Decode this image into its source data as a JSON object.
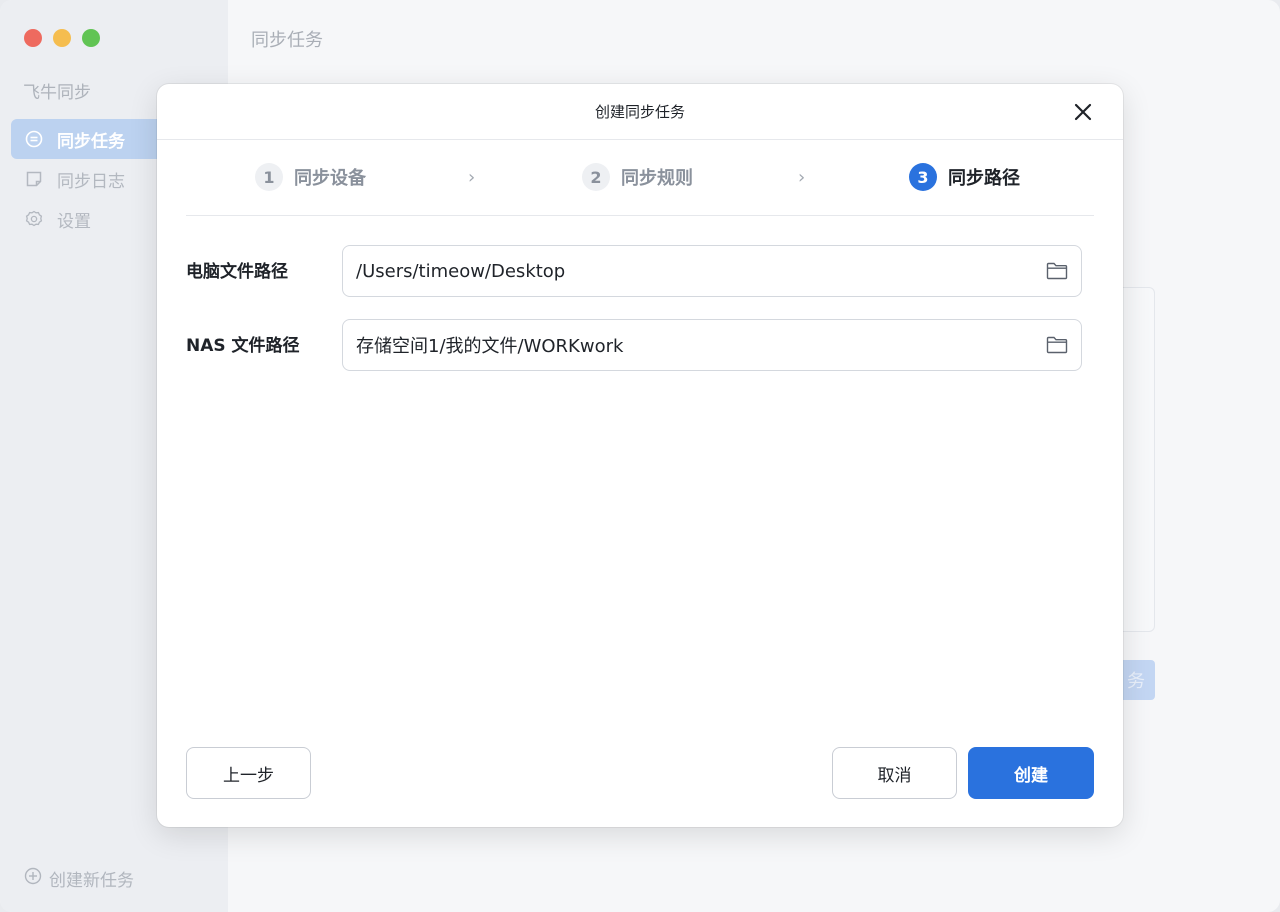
{
  "window": {
    "app_name": "飞牛同步",
    "main_title": "同步任务"
  },
  "sidebar": {
    "items": [
      {
        "label": "同步任务",
        "icon": "sync-icon",
        "active": true
      },
      {
        "label": "同步日志",
        "icon": "log-icon",
        "active": false
      },
      {
        "label": "设置",
        "icon": "gear-icon",
        "active": false
      }
    ],
    "new_task_label": "创建新任务"
  },
  "background": {
    "ghost_button_text": "务"
  },
  "modal": {
    "title": "创建同步任务",
    "steps": [
      {
        "number": "1",
        "label": "同步设备",
        "state": "done"
      },
      {
        "number": "2",
        "label": "同步规则",
        "state": "done"
      },
      {
        "number": "3",
        "label": "同步路径",
        "state": "active"
      }
    ],
    "fields": {
      "computer_path": {
        "label": "电脑文件路径",
        "value": "/Users/timeow/Desktop"
      },
      "nas_path": {
        "label": "NAS 文件路径",
        "value": "存储空间1/我的文件/WORKwork"
      }
    },
    "buttons": {
      "prev": "上一步",
      "cancel": "取消",
      "create": "创建"
    }
  },
  "colors": {
    "accent": "#2a72de",
    "sidebar_active_bg": "#bcd2f0",
    "traffic_red": "#ee6a5f",
    "traffic_yellow": "#f5bd4f",
    "traffic_green": "#61c454"
  }
}
